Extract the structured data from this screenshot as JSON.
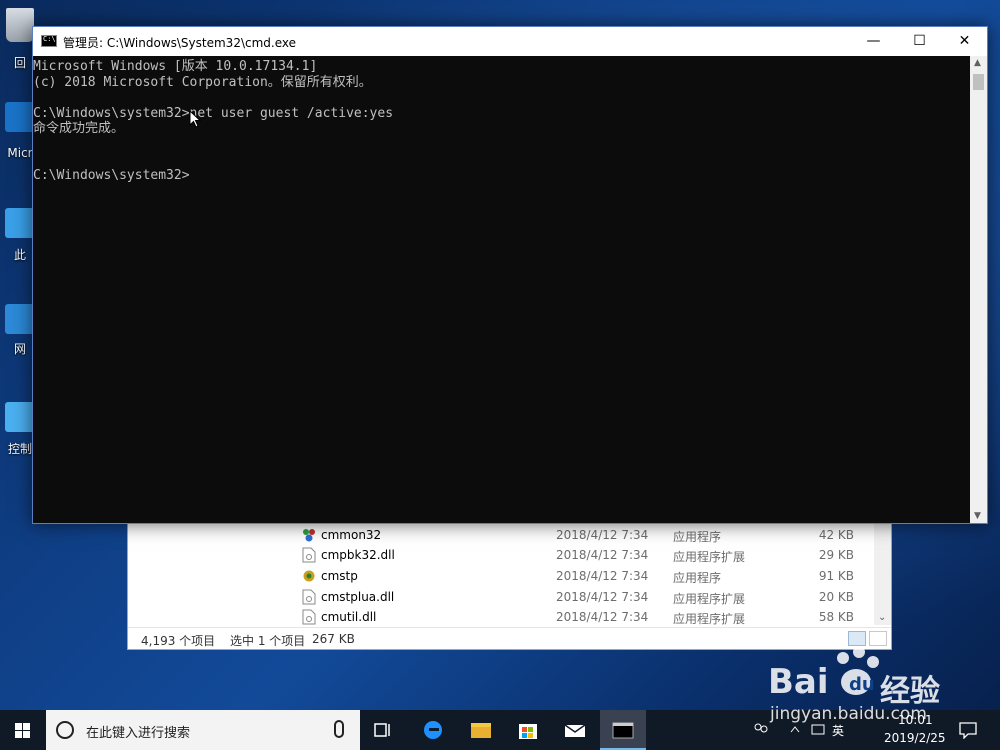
{
  "desktop": {
    "icons": [
      {
        "name": "recycle-bin",
        "label": "回"
      },
      {
        "name": "edge",
        "label": "Micr"
      },
      {
        "name": "this-pc",
        "label": "此"
      },
      {
        "name": "network",
        "label": "网"
      },
      {
        "name": "control-panel",
        "label": "控制"
      }
    ]
  },
  "cmd": {
    "title": "管理员: C:\\Windows\\System32\\cmd.exe",
    "lines": [
      "Microsoft Windows [版本 10.0.17134.1]",
      "(c) 2018 Microsoft Corporation。保留所有权利。",
      "",
      "C:\\Windows\\system32>net user guest /active:yes",
      "命令成功完成。",
      "",
      "",
      "C:\\Windows\\system32>"
    ],
    "buttons": {
      "minimize": "—",
      "maximize": "☐",
      "close": "✕"
    }
  },
  "explorer": {
    "files": [
      {
        "name": "cmmon32",
        "date": "2018/4/12 7:34",
        "type": "应用程序",
        "size": "42 KB",
        "icon": "app-icon"
      },
      {
        "name": "cmpbk32.dll",
        "date": "2018/4/12 7:34",
        "type": "应用程序扩展",
        "size": "29 KB",
        "icon": "dll-icon"
      },
      {
        "name": "cmstp",
        "date": "2018/4/12 7:34",
        "type": "应用程序",
        "size": "91 KB",
        "icon": "app-icon"
      },
      {
        "name": "cmstplua.dll",
        "date": "2018/4/12 7:34",
        "type": "应用程序扩展",
        "size": "20 KB",
        "icon": "dll-icon"
      },
      {
        "name": "cmutil.dll",
        "date": "2018/4/12 7:34",
        "type": "应用程序扩展",
        "size": "58 KB",
        "icon": "dll-icon"
      }
    ],
    "status": {
      "count": "4,193 个项目",
      "selected": "选中 1 个项目",
      "size": "267 KB"
    }
  },
  "taskbar": {
    "search_placeholder": "在此键入进行搜索",
    "ime": "英",
    "time": "10:01",
    "date": "2019/2/25"
  },
  "watermark": {
    "brand": "Bai",
    "brand_suffix": "经验",
    "url": "jingyan.baidu.com"
  }
}
